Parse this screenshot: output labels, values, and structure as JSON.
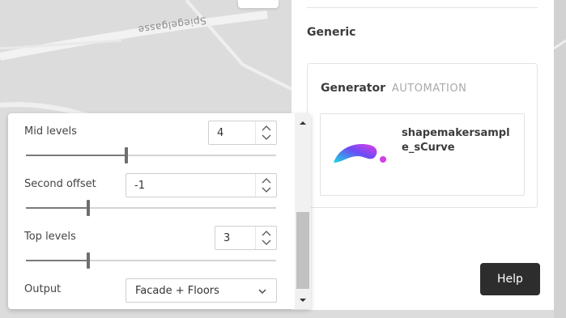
{
  "map": {
    "street_name": "Spiegelgasse"
  },
  "right_panel": {
    "section_heading": "Generic",
    "generator": {
      "title": "Generator",
      "tag": "AUTOMATION",
      "sample_name": "shapemakersample_sCurve"
    },
    "help_label": "Help"
  },
  "params": {
    "mid_levels": {
      "label": "Mid levels",
      "value": "4",
      "slider_fraction": 0.4
    },
    "second_offset": {
      "label": "Second offset",
      "value": "-1",
      "slider_fraction": 0.25
    },
    "top_levels": {
      "label": "Top levels",
      "value": "3",
      "slider_fraction": 0.25
    },
    "output": {
      "label": "Output",
      "value": "Facade + Floors"
    }
  },
  "colors": {
    "help_button_bg": "#2d2d2d",
    "gradient_start": "#16d9e3",
    "gradient_mid": "#6b4cf5",
    "gradient_end": "#e23de6"
  }
}
